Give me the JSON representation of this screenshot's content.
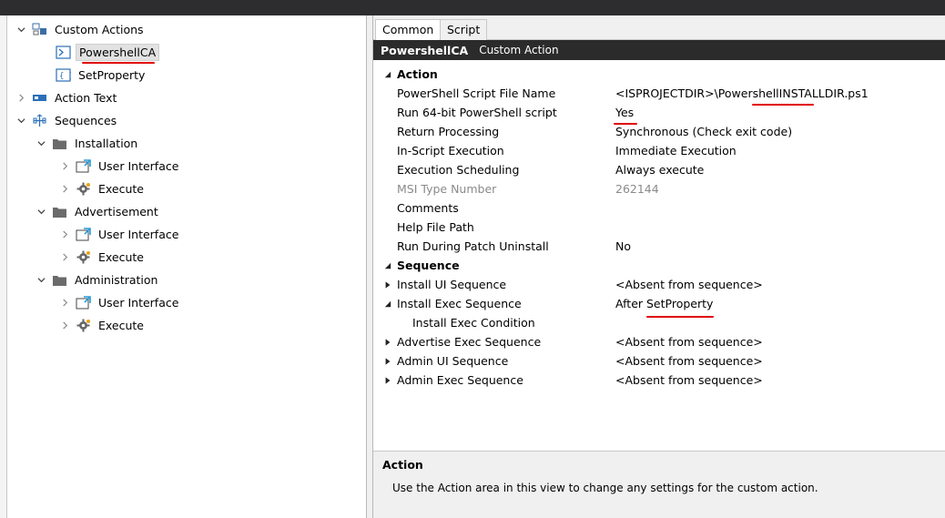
{
  "tree": {
    "items": [
      {
        "label": "Custom Actions",
        "icon": "custom-actions-icon",
        "expander": "expanded"
      },
      {
        "label": "PowershellCA",
        "icon": "powershell-icon",
        "selected": true
      },
      {
        "label": "SetProperty",
        "icon": "property-icon"
      },
      {
        "label": "Action Text",
        "icon": "action-text-icon",
        "expander": "collapsed"
      },
      {
        "label": "Sequences",
        "icon": "sequences-icon",
        "expander": "expanded"
      },
      {
        "label": "Installation",
        "icon": "folder-icon",
        "expander": "expanded"
      },
      {
        "label": "User Interface",
        "icon": "user-interface-icon",
        "expander": "collapsed"
      },
      {
        "label": "Execute",
        "icon": "execute-gear-icon",
        "expander": "collapsed"
      },
      {
        "label": "Advertisement",
        "icon": "folder-icon",
        "expander": "expanded"
      },
      {
        "label": "User Interface",
        "icon": "user-interface-icon",
        "expander": "collapsed"
      },
      {
        "label": "Execute",
        "icon": "execute-gear-icon",
        "expander": "collapsed"
      },
      {
        "label": "Administration",
        "icon": "folder-icon",
        "expander": "expanded"
      },
      {
        "label": "User Interface",
        "icon": "user-interface-icon",
        "expander": "collapsed"
      },
      {
        "label": "Execute",
        "icon": "execute-gear-icon",
        "expander": "collapsed"
      }
    ]
  },
  "tabs": [
    {
      "label": "Common",
      "active": true
    },
    {
      "label": "Script",
      "active": false
    }
  ],
  "header": {
    "title": "PowershellCA",
    "subtitle": "Custom Action"
  },
  "properties": {
    "action_category": "Action",
    "sequence_category": "Sequence",
    "action_rows": [
      {
        "name": "PowerShell Script File Name",
        "value": "<ISPROJECTDIR>\\PowershellINSTALLDIR.ps1"
      },
      {
        "name": "Run 64-bit PowerShell script",
        "value": "Yes"
      },
      {
        "name": "Return Processing",
        "value": "Synchronous (Check exit code)"
      },
      {
        "name": "In-Script Execution",
        "value": "Immediate Execution"
      },
      {
        "name": "Execution Scheduling",
        "value": "Always execute"
      },
      {
        "name": "MSI Type Number",
        "value": "262144",
        "disabled": true
      },
      {
        "name": "Comments",
        "value": ""
      },
      {
        "name": "Help File Path",
        "value": ""
      },
      {
        "name": "Run During Patch Uninstall",
        "value": "No"
      }
    ],
    "sequence_rows": [
      {
        "name": "Install UI Sequence",
        "value": "<Absent from sequence>",
        "expander": "collapsed"
      },
      {
        "name": "Install Exec Sequence",
        "value": "After SetProperty",
        "expander": "expanded"
      },
      {
        "name": "Install Exec Condition",
        "value": "",
        "child": true
      },
      {
        "name": "Advertise Exec Sequence",
        "value": "<Absent from sequence>",
        "expander": "collapsed"
      },
      {
        "name": "Admin UI Sequence",
        "value": "<Absent from sequence>",
        "expander": "collapsed"
      },
      {
        "name": "Admin Exec Sequence",
        "value": "<Absent from sequence>",
        "expander": "collapsed"
      }
    ]
  },
  "help": {
    "title": "Action",
    "text": "Use the Action area in this view to change any settings for the custom action."
  },
  "colors": {
    "annotation_underline": "#e00000",
    "header_bar": "#2b2b2b",
    "top_bar": "#2d2d30"
  }
}
